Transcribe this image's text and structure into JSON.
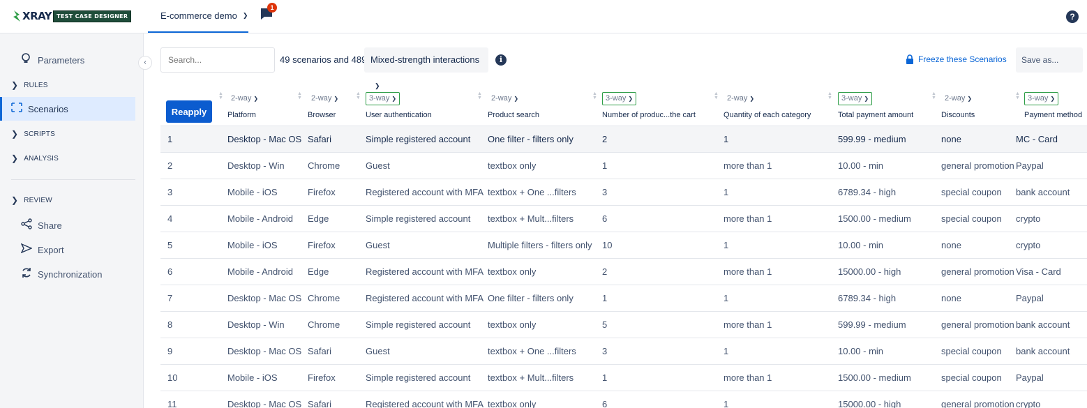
{
  "app": {
    "logo_text": "XRAY",
    "logo_badge": "TEST CASE DESIGNER",
    "project": "E-commerce demo",
    "notification_count": "1",
    "help": "?"
  },
  "sidebar": {
    "collapse_glyph": "‹",
    "parameters": "Parameters",
    "rules": "RULES",
    "scenarios": "Scenarios",
    "scripts": "SCRIPTS",
    "analysis": "ANALYSIS",
    "review": "REVIEW",
    "share": "Share",
    "export": "Export",
    "synchronization": "Synchronization"
  },
  "toolbar": {
    "search_placeholder": "Search...",
    "scenario_count": "49 scenarios and 489",
    "strength": "Mixed-strength interactions",
    "info": "i",
    "freeze": "Freeze these Scenarios",
    "save_as": "Save as..."
  },
  "table": {
    "reapply": "Reapply",
    "columns": [
      {
        "way": "2-way",
        "name": "Platform",
        "highlight": false
      },
      {
        "way": "2-way",
        "name": "Browser",
        "highlight": false
      },
      {
        "way": "3-way",
        "name": "User authentication",
        "highlight": true
      },
      {
        "way": "2-way",
        "name": "Product search",
        "highlight": false
      },
      {
        "way": "3-way",
        "name": "Number of produc...the cart",
        "highlight": true
      },
      {
        "way": "2-way",
        "name": "Quantity of each category",
        "highlight": false
      },
      {
        "way": "3-way",
        "name": "Total payment amount",
        "highlight": true
      },
      {
        "way": "2-way",
        "name": "Discounts",
        "highlight": false
      },
      {
        "way": "3-way",
        "name": "Payment method",
        "highlight": true
      }
    ],
    "rows": [
      [
        "1",
        "Desktop - Mac OS",
        "Safari",
        "Simple registered account",
        "One filter - filters only",
        "2",
        "1",
        "599.99 - medium",
        "none",
        "MC - Card"
      ],
      [
        "2",
        "Desktop - Win",
        "Chrome",
        "Guest",
        "textbox only",
        "1",
        "more than 1",
        "10.00 - min",
        "general promotion",
        "Paypal"
      ],
      [
        "3",
        "Mobile - iOS",
        "Firefox",
        "Registered account with MFA",
        "textbox + One ...filters",
        "3",
        "1",
        "6789.34 - high",
        "special coupon",
        "bank account"
      ],
      [
        "4",
        "Mobile - Android",
        "Edge",
        "Simple registered account",
        "textbox + Mult...filters",
        "6",
        "more than 1",
        "1500.00 - medium",
        "special coupon",
        "crypto"
      ],
      [
        "5",
        "Mobile - iOS",
        "Firefox",
        "Guest",
        "Multiple filters - filters only",
        "10",
        "1",
        "10.00 - min",
        "none",
        "crypto"
      ],
      [
        "6",
        "Mobile - Android",
        "Edge",
        "Registered account with MFA",
        "textbox only",
        "2",
        "more than 1",
        "15000.00 - high",
        "general promotion",
        "Visa - Card"
      ],
      [
        "7",
        "Desktop - Mac OS",
        "Chrome",
        "Registered account with MFA",
        "One filter - filters only",
        "1",
        "1",
        "6789.34 - high",
        "none",
        "Paypal"
      ],
      [
        "8",
        "Desktop - Win",
        "Chrome",
        "Simple registered account",
        "textbox only",
        "5",
        "more than 1",
        "599.99 - medium",
        "general promotion",
        "bank account"
      ],
      [
        "9",
        "Desktop - Mac OS",
        "Safari",
        "Guest",
        "textbox + One ...filters",
        "3",
        "1",
        "10.00 - min",
        "special coupon",
        "bank account"
      ],
      [
        "10",
        "Mobile - iOS",
        "Firefox",
        "Simple registered account",
        "textbox + Mult...filters",
        "1",
        "more than 1",
        "1500.00 - medium",
        "special coupon",
        "Paypal"
      ],
      [
        "11",
        "Desktop - Mac OS",
        "Safari",
        "Registered account with MFA",
        "textbox only",
        "6",
        "1",
        "15000.00 - high",
        "general promotion",
        "crypto"
      ]
    ]
  },
  "colors": {
    "accent": "#0b66d6",
    "highlight_border": "#2e9d47",
    "badge": "#de350b"
  }
}
